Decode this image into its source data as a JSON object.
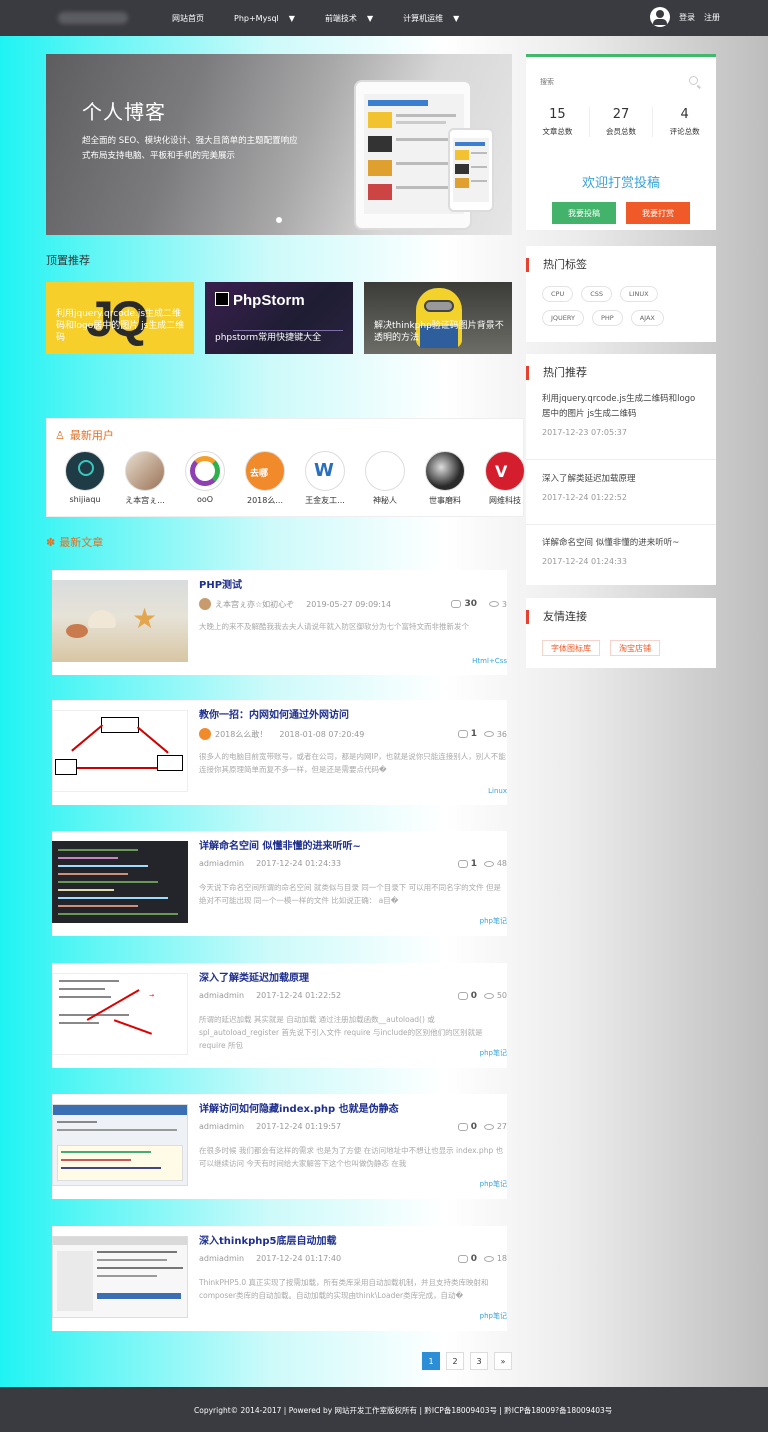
{
  "nav": {
    "items": [
      {
        "label": "网站首页",
        "has_caret": false
      },
      {
        "label": "Php+Mysql",
        "has_caret": true
      },
      {
        "label": "前端技术",
        "has_caret": true
      },
      {
        "label": "计算机运维",
        "has_caret": true
      }
    ],
    "login": "登录",
    "register": "注册"
  },
  "banner": {
    "title": "个人博客",
    "description": "超全面的 SEO、模块化设计、强大且简单的主题配置响应式布局支持电脑、平板和手机的完美展示"
  },
  "top_section": {
    "title": "顶置推荐",
    "cards": [
      {
        "caption": "利用jquery.qrcode.js生成二维码和logo居中的图片 js生成二维码",
        "bg": "#f6cf2a",
        "art": "JQ"
      },
      {
        "caption": "phpstorm常用快捷键大全",
        "bg": "#27223e",
        "art": "PhpStorm"
      },
      {
        "caption": "解决thinkphp验证码图片背景不透明的方法",
        "bg": "#5e5e5a",
        "art": ""
      }
    ]
  },
  "new_users": {
    "title": "最新用户",
    "users": [
      {
        "name": "shijiaqu",
        "color": "#1f3b45"
      },
      {
        "name": "え本宫ぇ...",
        "color": "#b7997d"
      },
      {
        "name": "ooO",
        "color": "#8e3fb2"
      },
      {
        "name": "2018么...",
        "color": "#f08a2b"
      },
      {
        "name": "王金友工...",
        "color": "#f2d34f"
      },
      {
        "name": "神秘人",
        "color": "#ffffff"
      },
      {
        "name": "世事磨料",
        "color": "#2a2a2a"
      },
      {
        "name": "网维科技",
        "color": "#d41e2e"
      }
    ]
  },
  "latest": {
    "title": "最新文章",
    "articles": [
      {
        "title": "PHP测试",
        "author": "え本宫ぇ亦☆如初心ぞ",
        "time": "2019-05-27 09:09:14",
        "comments": "30",
        "views": "3",
        "desc": "大晚上的来不及解酷我我去夫人请说年就入防区御软分为七个富特文而非推新发个",
        "tag": "Html+Css",
        "thumb": "beach"
      },
      {
        "title": "教你一招：内网如何通过外网访问",
        "author": "2018么么敢！",
        "time": "2018-01-08 07:20:49",
        "comments": "1",
        "views": "36",
        "desc": "很多人的电脑目前宽带账号，或者在公司，都是内网IP，也就是说你只能连接别人，别人不能连接你其原理简单而复不多一样，但是还是需要点代码�",
        "tag": "Linux",
        "thumb": "diagram"
      },
      {
        "title": "详解命名空间 似懂非懂的进来听听~",
        "author": "admiadmin",
        "time": "2017-12-24 01:24:33",
        "comments": "1",
        "views": "48",
        "desc": "今天说下命名空间所谓的命名空间 就类似与目录 同一个目录下 可以用不同名字的文件 但是绝对不可能出现 同一个一模一样的文件 比如说正确： a目�",
        "tag": "php笔记",
        "thumb": "code"
      },
      {
        "title": "深入了解类延迟加载原理",
        "author": "admiadmin",
        "time": "2017-12-24 01:22:52",
        "comments": "0",
        "views": "50",
        "desc": "所谓的延迟加载 其实就是 自动加载 通过注册加载函数__autoload() 或 spl_autoload_register 首先说下引入文件 require 与include的区别他们的区别就是 require 所包",
        "tag": "php笔记",
        "thumb": "annot"
      },
      {
        "title": "详解访问如何隐藏index.php 也就是伪静态",
        "author": "admiadmin",
        "time": "2017-12-24 01:19:57",
        "comments": "0",
        "views": "27",
        "desc": "在很多时候 我们都会有这样的需求 也是为了方便 在访问地址中不想让也显示 index.php 也可以继续访问 今天有时间给大家解答下这个也叫做伪静态 在我",
        "tag": "php笔记",
        "thumb": "ide"
      },
      {
        "title": "深入thinkphp5底层自动加载",
        "author": "admiadmin",
        "time": "2017-12-24 01:17:40",
        "comments": "0",
        "views": "18",
        "desc": "ThinkPHP5.0 真正实现了按需加载，所有类库采用自动加载机制，并且支持类库映射和composer类库的自动加载。自动加载的实现由think\\Loader类库完成，自动�",
        "tag": "php笔记",
        "thumb": "ide2"
      }
    ]
  },
  "pagination": {
    "pages": [
      "1",
      "2",
      "3"
    ],
    "next": "»",
    "current": "1"
  },
  "sidebar": {
    "search_placeholder": "搜索",
    "stats": [
      {
        "value": "15",
        "label": "文章总数"
      },
      {
        "value": "27",
        "label": "会员总数"
      },
      {
        "value": "4",
        "label": "评论总数"
      }
    ],
    "welcome": "欢迎打赏投稿",
    "contribute_btn": "我要投稿",
    "reward_btn": "我要打赏",
    "hot_tags_title": "热门标签",
    "tags": [
      "CPU",
      "CSS",
      "LINUX",
      "JQUERY",
      "PHP",
      "AJAX"
    ],
    "hot_rec_title": "热门推荐",
    "hot_rec": [
      {
        "title": "利用jquery.qrcode.js生成二维码和logo居中的图片 js生成二维码",
        "date": "2017-12-23 07:05:37"
      },
      {
        "title": "深入了解类延迟加载原理",
        "date": "2017-12-24 01:22:52"
      },
      {
        "title": "详解命名空间 似懂非懂的进来听听~",
        "date": "2017-12-24 01:24:33"
      }
    ],
    "links_title": "友情连接",
    "links": [
      "字体图标库",
      "淘宝店铺"
    ]
  },
  "footer": {
    "text": "Copyright© 2014-2017 | Powered by 网站开发工作室版权所有 | 黔ICP备18009403号 | 黔ICP备18009?备18009403号"
  },
  "colors": {
    "accent_green": "#41b96c",
    "accent_orange": "#f05a28",
    "title_blue": "#1e2f8f",
    "link_blue": "#3aa3dc",
    "nav_bg": "#3a3b41"
  }
}
